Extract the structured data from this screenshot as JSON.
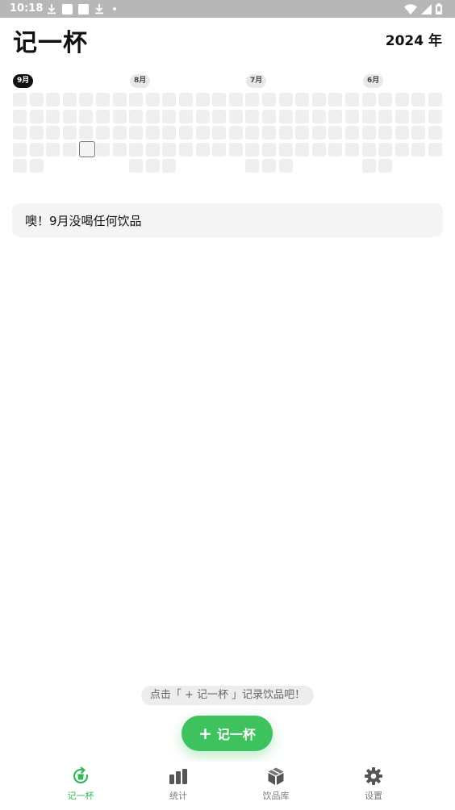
{
  "status_bar": {
    "time": "10:18",
    "left_icons": [
      "download-icon",
      "square-notification-icon",
      "square-notification-icon",
      "download-icon",
      "dot-icon"
    ],
    "right_icons": [
      "wifi-icon",
      "cell-signal-icon",
      "battery-icon"
    ]
  },
  "header": {
    "title": "记一杯",
    "year": "2024 年"
  },
  "calendar": {
    "months": [
      {
        "label": "9月",
        "active": true
      },
      {
        "label": "8月",
        "active": false
      },
      {
        "label": "7月",
        "active": false
      },
      {
        "label": "6月",
        "active": false
      }
    ],
    "today_marker": "today-cell"
  },
  "empty_state": {
    "message": "噢！9月没喝任何饮品"
  },
  "hint": "点击「 + 记一杯 」记录饮品吧！",
  "fab": {
    "plus": "+",
    "label": "记一杯"
  },
  "bottom_nav": {
    "items": [
      {
        "label": "记一杯",
        "icon": "cup-record-icon",
        "active": true
      },
      {
        "label": "统计",
        "icon": "bar-chart-icon",
        "active": false
      },
      {
        "label": "饮品库",
        "icon": "box-icon",
        "active": false
      },
      {
        "label": "设置",
        "icon": "gear-icon",
        "active": false
      }
    ]
  },
  "colors": {
    "accent": "#3ec25e",
    "active_nav": "#33b857",
    "cell": "#efefef",
    "card_bg": "#f4f4f4",
    "status_bar": "#b7b7b7"
  }
}
